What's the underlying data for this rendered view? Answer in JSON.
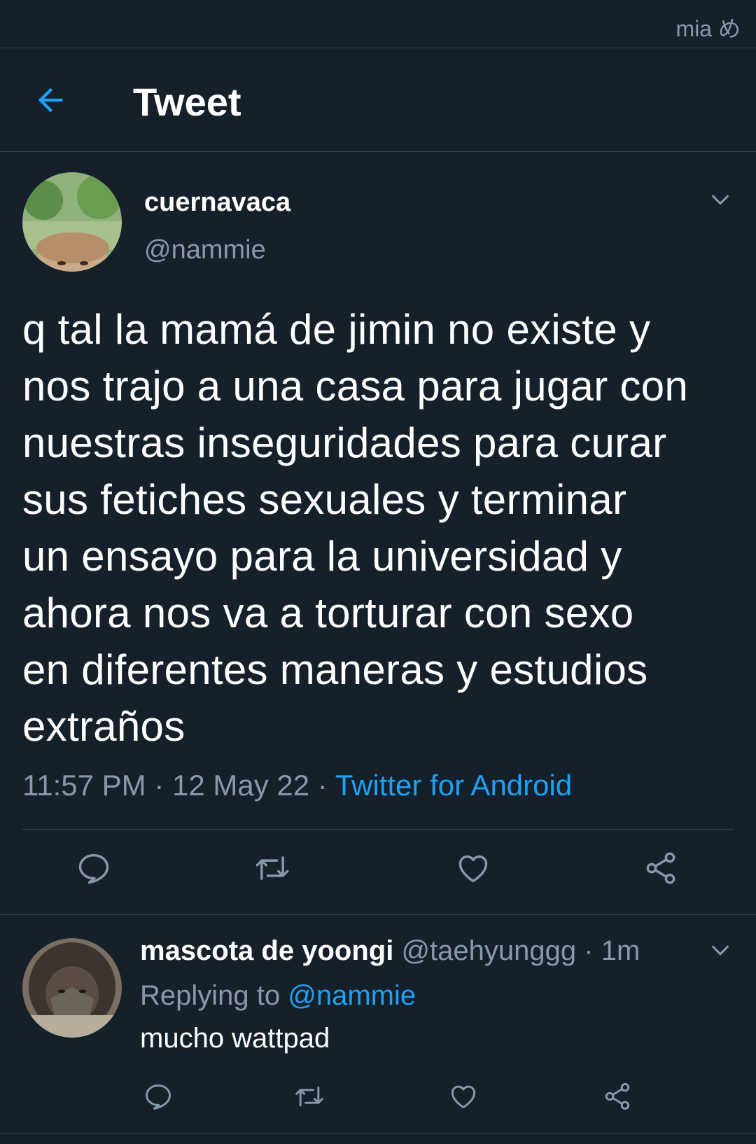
{
  "watermark": "mia め",
  "header": {
    "title": "Tweet",
    "back_icon": "arrow-left-icon"
  },
  "tweet": {
    "author_name": "cuernavaca",
    "author_handle": "@nammie",
    "text": "q tal la mamá de jimin no existe y\nnos trajo a una casa para jugar con\nnuestras inseguridades para curar\nsus fetiches sexuales y terminar\nun ensayo para la universidad y\nahora nos va a torturar con sexo\nen diferentes maneras y estudios\nextraños",
    "time": "11:57 PM",
    "date": "12 May 22",
    "separator": "·",
    "source": "Twitter for Android"
  },
  "actions": {
    "icons": [
      "reply-icon",
      "retweet-icon",
      "like-icon",
      "share-icon"
    ]
  },
  "reply": {
    "author_name": "mascota de yoongi",
    "author_handle": "@taehyunggg",
    "separator": "·",
    "time": "1m",
    "replying_to_label": "Replying to",
    "replying_to_handle": "@nammie",
    "text": "mucho wattpad"
  },
  "colors": {
    "background": "#15202b",
    "accent": "#1da1f2",
    "secondary_text": "#8899a6",
    "divider": "#38444d"
  }
}
